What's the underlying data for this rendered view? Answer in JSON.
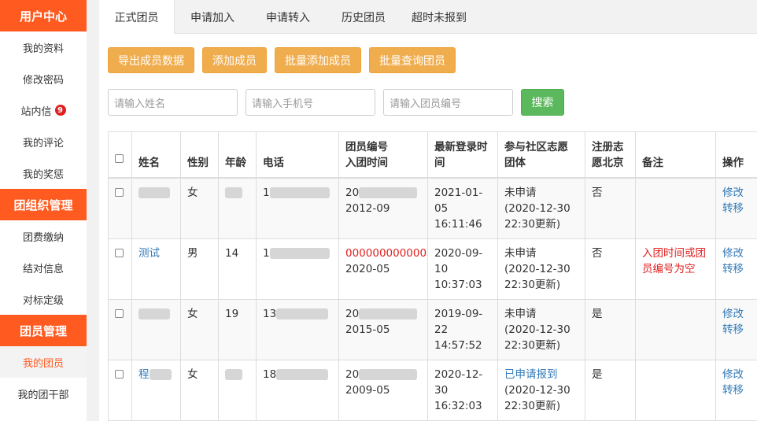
{
  "sidebar": {
    "sections": [
      {
        "title": "用户中心",
        "items": [
          {
            "label": "我的资料"
          },
          {
            "label": "修改密码"
          },
          {
            "label": "站内信",
            "badge": "9"
          },
          {
            "label": "我的评论"
          },
          {
            "label": "我的奖惩"
          }
        ]
      },
      {
        "title": "团组织管理",
        "items": [
          {
            "label": "团费缴纳"
          },
          {
            "label": "结对信息"
          },
          {
            "label": "对标定级"
          }
        ]
      },
      {
        "title": "团员管理",
        "items": [
          {
            "label": "我的团员",
            "active": true
          },
          {
            "label": "我的团干部"
          }
        ]
      }
    ]
  },
  "tabs": [
    "正式团员",
    "申请加入",
    "申请转入",
    "历史团员",
    "超时未报到"
  ],
  "toolbar": {
    "export": "导出成员数据",
    "add": "添加成员",
    "batch_add": "批量添加成员",
    "batch_query": "批量查询团员"
  },
  "search": {
    "name_placeholder": "请输入姓名",
    "phone_placeholder": "请输入手机号",
    "id_placeholder": "请输入团员编号",
    "button": "搜索"
  },
  "table": {
    "headers": {
      "name": "姓名",
      "gender": "性别",
      "age": "年龄",
      "phone": "电话",
      "id_line1": "团员编号",
      "id_line2": "入团时间",
      "login": "最新登录时间",
      "volunteer": "参与社区志愿团体",
      "registered": "注册志愿北京",
      "remark": "备注",
      "actions": "操作"
    },
    "rows": [
      {
        "name": "",
        "gender": "女",
        "age": "",
        "phone": "1",
        "member_id": "20",
        "join_date": "2012-09",
        "login": "2021-01-05 16:11:46",
        "vol_status": "未申请",
        "vol_update": "(2020-12-30 22:30更新)",
        "registered": "否",
        "remark": "",
        "edit": "修改",
        "transfer": "转移"
      },
      {
        "name": "测试",
        "gender": "男",
        "age": "14",
        "phone": "1",
        "member_id": "000000000000",
        "join_date": "2020-05",
        "login": "2020-09-10 10:37:03",
        "vol_status": "未申请",
        "vol_update": "(2020-12-30 22:30更新)",
        "registered": "否",
        "remark": "入团时间或团员编号为空",
        "edit": "修改",
        "transfer": "转移"
      },
      {
        "name": "",
        "gender": "女",
        "age": "19",
        "phone": "13",
        "member_id": "20",
        "join_date": "2015-05",
        "login": "2019-09-22 14:57:52",
        "vol_status": "未申请",
        "vol_update": "(2020-12-30 22:30更新)",
        "registered": "是",
        "remark": "",
        "edit": "修改",
        "transfer": "转移"
      },
      {
        "name": "程",
        "gender": "女",
        "age": "",
        "phone": "18",
        "member_id": "20",
        "join_date": "2009-05",
        "login": "2020-12-30 16:32:03",
        "vol_status": "已申请报到",
        "vol_update": "(2020-12-30 22:30更新)",
        "registered": "是",
        "remark": "",
        "edit": "修改",
        "transfer": "转移"
      }
    ]
  },
  "colors": {
    "accent": "#ff5a1f",
    "warning_btn": "#f0ad4e",
    "success_btn": "#5cb85c",
    "link": "#337ab7",
    "error": "#e02020"
  }
}
